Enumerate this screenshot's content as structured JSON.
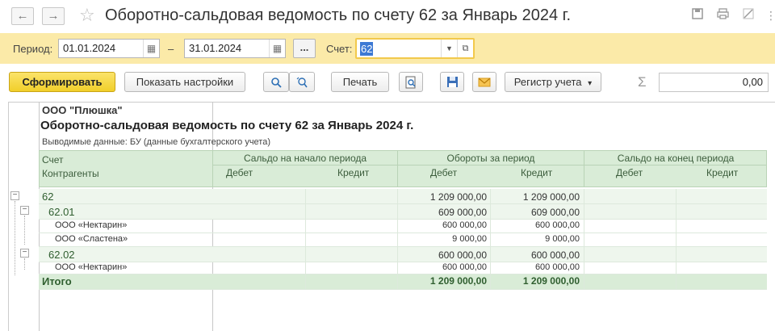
{
  "window": {
    "title": "Оборотно-сальдовая ведомость по счету 62 за Январь 2024 г.",
    "back_glyph": "←",
    "forward_glyph": "→",
    "favorite_glyph": "☆",
    "icons": [
      "save-icon",
      "print-icon",
      "link-icon"
    ]
  },
  "params": {
    "period_label": "Период:",
    "date_from": "01.01.2024",
    "dash": "–",
    "date_to": "31.01.2024",
    "select_period_label": "...",
    "account_label": "Счет:",
    "account_value": "62"
  },
  "toolbar": {
    "generate_label": "Сформировать",
    "settings_label": "Показать настройки",
    "print_label": "Печать",
    "registry_label": "Регистр учета",
    "registry_arrow": "▾",
    "sum_symbol": "Σ",
    "sum_value": "0,00"
  },
  "report": {
    "org_name": "ООО \"Плюшка\"",
    "heading": "Оборотно-сальдовая ведомость по счету 62 за Январь 2024 г.",
    "data_note": "Выводимые данные: БУ (данные бухгалтерского учета)",
    "columns": {
      "account": "Счет",
      "counterparties": "Контрагенты",
      "opening_balance": "Сальдо на начало периода",
      "turnover": "Обороты за период",
      "closing_balance": "Сальдо на конец периода",
      "debit": "Дебет",
      "credit": "Кредит"
    },
    "rows": [
      {
        "name": "62",
        "debit_turnover": "1 209 000,00",
        "credit_turnover": "1 209 000,00"
      },
      {
        "name": "62.01",
        "debit_turnover": "609 000,00",
        "credit_turnover": "609 000,00"
      },
      {
        "name": "ООО «Нектарин»",
        "debit_turnover": "600 000,00",
        "credit_turnover": "600 000,00"
      },
      {
        "name": "ООО «Сластена»",
        "debit_turnover": "9 000,00",
        "credit_turnover": "9 000,00"
      },
      {
        "name": "62.02",
        "debit_turnover": "600 000,00",
        "credit_turnover": "600 000,00"
      },
      {
        "name": "ООО «Нектарин»",
        "debit_turnover": "600 000,00",
        "credit_turnover": "600 000,00"
      },
      {
        "name": "Итого",
        "debit_turnover": "1 209 000,00",
        "credit_turnover": "1 209 000,00"
      }
    ]
  }
}
